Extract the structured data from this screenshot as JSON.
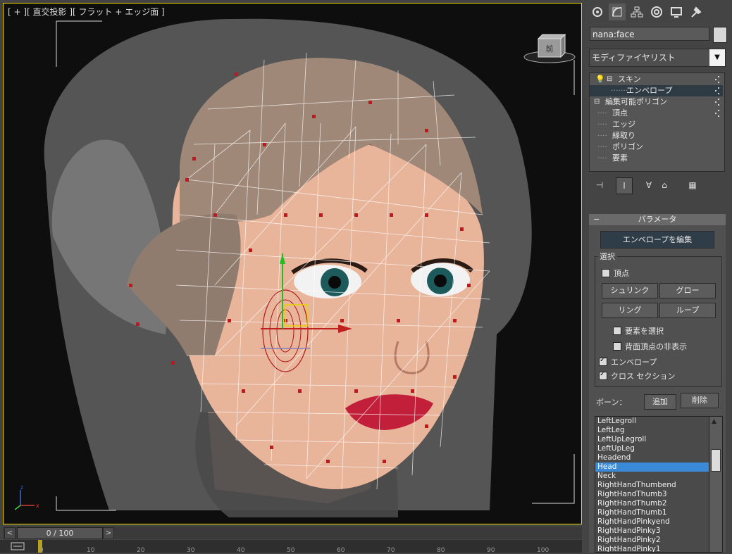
{
  "viewport": {
    "label": "[ + ][ 直交投影 ][ フラット + エッジ面 ]",
    "viewcube_label": "前"
  },
  "timeline": {
    "frame_readout": "0 / 100",
    "prev_arrow": "<",
    "next_arrow": ">",
    "ticks": [
      "0",
      "10",
      "20",
      "30",
      "40",
      "50",
      "60",
      "70",
      "80",
      "90",
      "100"
    ]
  },
  "panel": {
    "tab_icons": [
      "create-icon",
      "modify-icon",
      "hierarchy-icon",
      "motion-icon",
      "display-icon",
      "utilities-icon"
    ],
    "object_name": "nana:face",
    "modifier_list": "モディファイヤリスト",
    "stack": [
      {
        "label": "スキン",
        "level": 0
      },
      {
        "label": "エンベロープ",
        "level": 2
      },
      {
        "label": "編集可能ポリゴン",
        "level": 0
      },
      {
        "label": "頂点",
        "level": 1
      },
      {
        "label": "エッジ",
        "level": 1
      },
      {
        "label": "縁取り",
        "level": 1
      },
      {
        "label": "ポリゴン",
        "level": 1
      },
      {
        "label": "要素",
        "level": 1
      }
    ],
    "rollout": {
      "title": "パラメータ",
      "collapse": "−",
      "edit_envelopes": "エンベロープを編集",
      "selection_title": "選択",
      "vertices_label": "頂点",
      "vertices_checked": false,
      "shrink": "シュリンク",
      "grow": "グロー",
      "ring": "リング",
      "loop": "ループ",
      "select_element": "要素を選択",
      "select_element_checked": false,
      "backface_cull": "背面頂点の非表示",
      "backface_cull_checked": false,
      "envelopes": "エンベロープ",
      "envelopes_checked": true,
      "cross_sections": "クロス セクション",
      "cross_sections_checked": true,
      "bones_label": "ボーン：",
      "add": "追加",
      "remove": "削除",
      "bones": [
        "LeftLegroll",
        "LeftLeg",
        "LeftUpLegroll",
        "LeftUpLeg",
        "Headend",
        "Head",
        "Neck",
        "RightHandThumbend",
        "RightHandThumb3",
        "RightHandThumb2",
        "RightHandThumb1",
        "RightHandPinkyend",
        "RightHandPinky3",
        "RightHandPinky2",
        "RightHandPinky1"
      ],
      "selected_bone": "Head"
    }
  },
  "colors": {
    "viewport_border": "#f2d400",
    "selection_highlight": "#3a8ad8",
    "skin": "#e8b49a",
    "hair": "#8a7a6a",
    "vertex": "#c8141e"
  }
}
